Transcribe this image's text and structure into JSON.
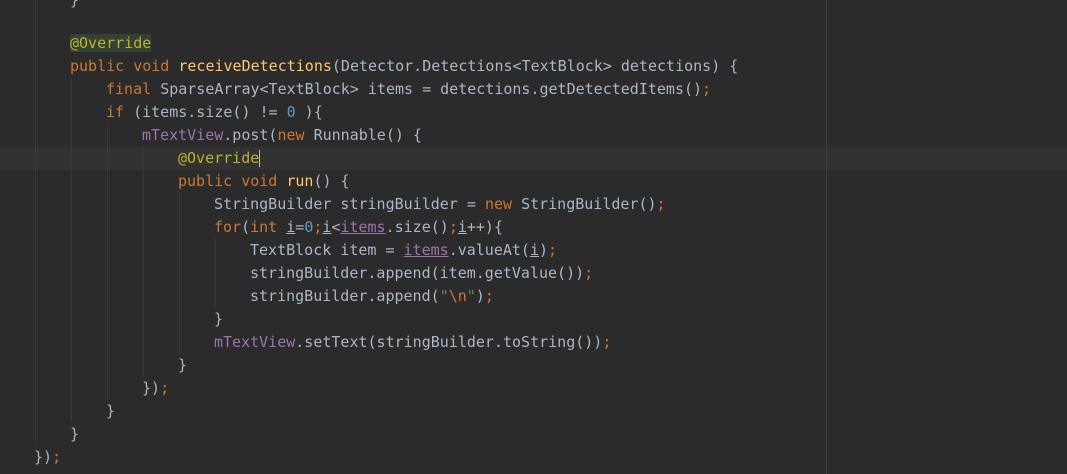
{
  "lines": [
    [
      {
        "t": "}",
        "c": "txt"
      }
    ],
    [
      {
        "t": "@Override",
        "c": "ann-hl"
      }
    ],
    [
      {
        "t": "public ",
        "c": "kw"
      },
      {
        "t": "void ",
        "c": "kw"
      },
      {
        "t": "receiveDetections",
        "c": "mth"
      },
      {
        "t": "(Detector.Detections<TextBlock> detections) {",
        "c": "txt"
      }
    ],
    [
      {
        "t": "final ",
        "c": "kw"
      },
      {
        "t": "SparseArray<TextBlock> items = detections.getDetectedItems()",
        "c": "txt"
      },
      {
        "t": ";",
        "c": "kw"
      }
    ],
    [
      {
        "t": "if ",
        "c": "kw"
      },
      {
        "t": "(items.size() != ",
        "c": "txt"
      },
      {
        "t": "0",
        "c": "num"
      },
      {
        "t": " ){",
        "c": "txt"
      }
    ],
    [
      {
        "t": "mTextView",
        "c": "fld"
      },
      {
        "t": ".post(",
        "c": "txt"
      },
      {
        "t": "new ",
        "c": "kw"
      },
      {
        "t": "Runnable() {",
        "c": "txt"
      }
    ],
    [
      {
        "t": "@Override",
        "c": "ann"
      }
    ],
    [
      {
        "t": "public ",
        "c": "kw"
      },
      {
        "t": "void ",
        "c": "kw"
      },
      {
        "t": "run",
        "c": "mth"
      },
      {
        "t": "() {",
        "c": "txt"
      }
    ],
    [
      {
        "t": "StringBuilder stringBuilder = ",
        "c": "txt"
      },
      {
        "t": "new ",
        "c": "kw"
      },
      {
        "t": "StringBuilder()",
        "c": "txt"
      },
      {
        "t": ";",
        "c": "kw"
      }
    ],
    [
      {
        "t": "for",
        "c": "kw"
      },
      {
        "t": "(",
        "c": "txt"
      },
      {
        "t": "int ",
        "c": "kw"
      },
      {
        "t": "i",
        "c": "und"
      },
      {
        "t": "=",
        "c": "txt"
      },
      {
        "t": "0",
        "c": "num"
      },
      {
        "t": ";",
        "c": "kw"
      },
      {
        "t": "i",
        "c": "und"
      },
      {
        "t": "<",
        "c": "txt"
      },
      {
        "t": "items",
        "c": "und-fld"
      },
      {
        "t": ".size()",
        "c": "txt"
      },
      {
        "t": ";",
        "c": "kw"
      },
      {
        "t": "i",
        "c": "und"
      },
      {
        "t": "++){",
        "c": "txt"
      }
    ],
    [
      {
        "t": "TextBlock item = ",
        "c": "txt"
      },
      {
        "t": "items",
        "c": "und-fld"
      },
      {
        "t": ".valueAt(",
        "c": "txt"
      },
      {
        "t": "i",
        "c": "und"
      },
      {
        "t": ")",
        "c": "txt"
      },
      {
        "t": ";",
        "c": "kw"
      }
    ],
    [
      {
        "t": "stringBuilder.append(item.getValue())",
        "c": "txt"
      },
      {
        "t": ";",
        "c": "kw"
      }
    ],
    [
      {
        "t": "stringBuilder.append(",
        "c": "txt"
      },
      {
        "t": "\"",
        "c": "str"
      },
      {
        "t": "\\n",
        "c": "esc"
      },
      {
        "t": "\"",
        "c": "str"
      },
      {
        "t": ")",
        "c": "txt"
      },
      {
        "t": ";",
        "c": "kw"
      }
    ],
    [
      {
        "t": "}",
        "c": "txt"
      }
    ],
    [
      {
        "t": "mTextView",
        "c": "fld"
      },
      {
        "t": ".setText(stringBuilder.toString())",
        "c": "txt"
      },
      {
        "t": ";",
        "c": "kw"
      }
    ],
    [
      {
        "t": "}",
        "c": "txt"
      }
    ],
    [
      {
        "t": "})",
        "c": "txt"
      },
      {
        "t": ";",
        "c": "kw"
      }
    ],
    [
      {
        "t": "}",
        "c": "txt"
      }
    ],
    [
      {
        "t": "}",
        "c": "txt"
      }
    ],
    [
      {
        "t": "})",
        "c": "txt"
      },
      {
        "t": ";",
        "c": "kw"
      }
    ]
  ]
}
